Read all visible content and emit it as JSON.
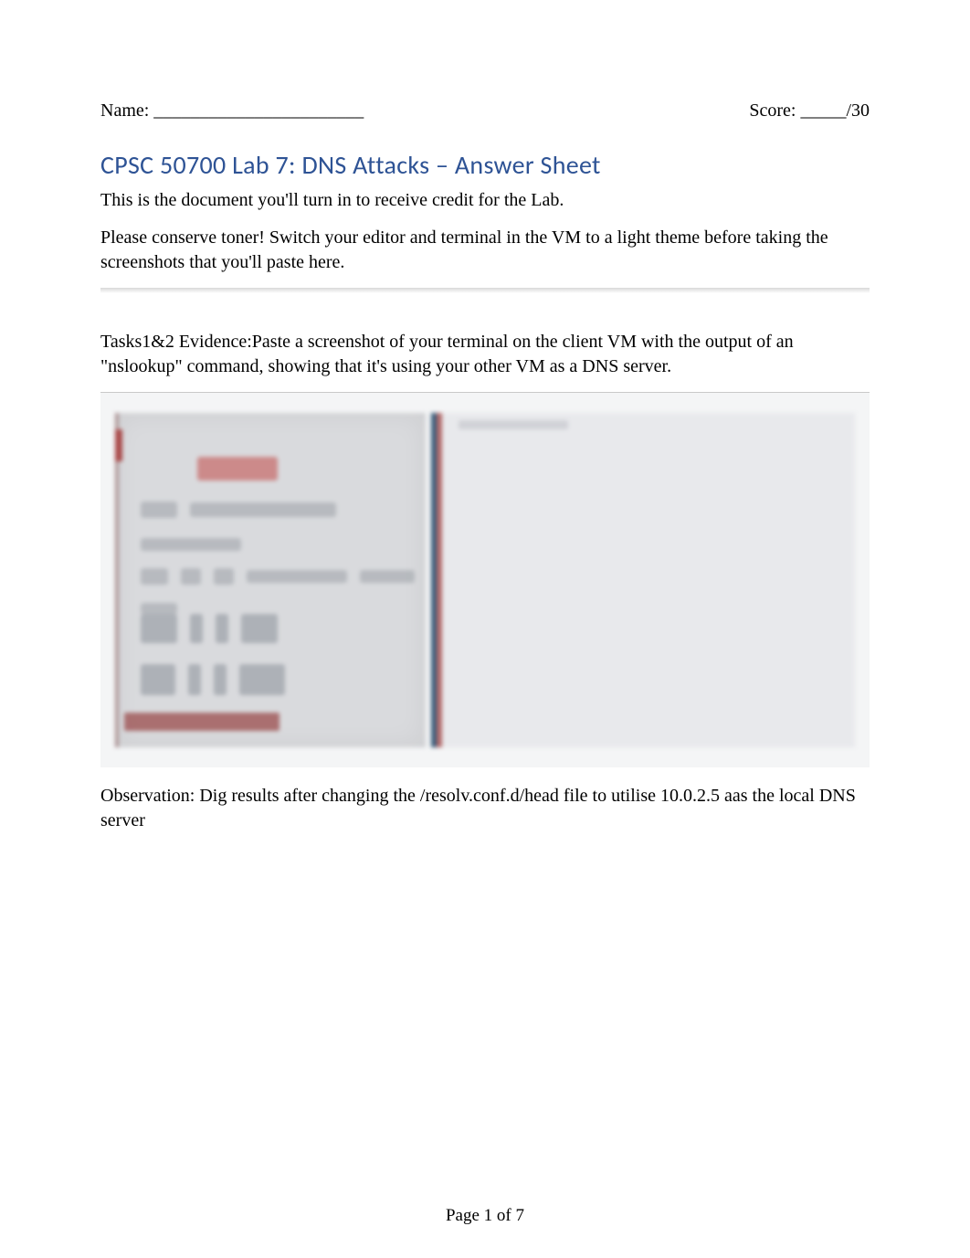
{
  "header": {
    "name_label": "Name: _______________________",
    "score_label": "Score: _____/30"
  },
  "title": "CPSC 50700 Lab 7: DNS Attacks – Answer Sheet",
  "intro1": "This is the document you'll turn in to receive credit for the Lab.",
  "intro2": "Please conserve toner!   Switch your editor and terminal in the VM to a light theme before taking the screenshots that you'll paste here.",
  "task_evidence_label": "Tasks1&2 Evidence:",
  "task_evidence_body": "Paste a screenshot of your terminal on the client VM with the output of an \"nslookup\" command, showing that it's using your other VM as a DNS server.",
  "observation_label": "Observation:",
  "observation_body": "   Dig results after changing the /resolv.conf.d/head file to utilise 10.0.2.5 aas the local DNS server",
  "footer": "Page 1 of 7"
}
